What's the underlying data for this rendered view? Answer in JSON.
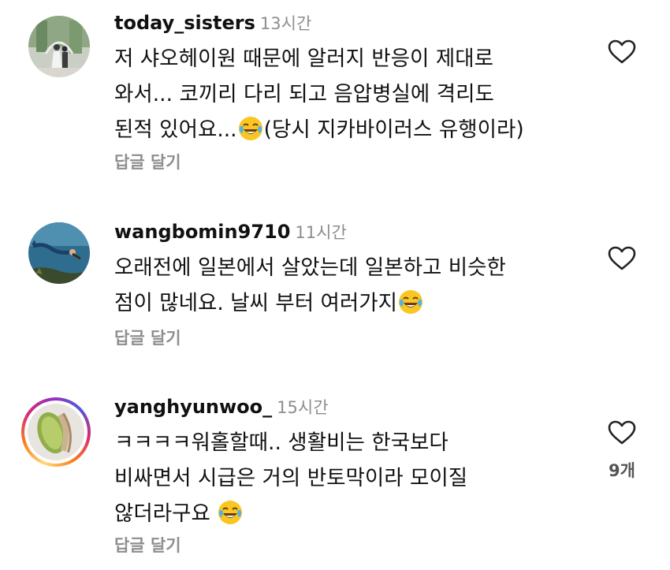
{
  "comments": [
    {
      "username": "today_sisters",
      "time": "13시간",
      "lines": [
        "저 샤오헤이원 때문에 알러지 반응이 제대로",
        "와서... 코끼리 다리 되고 음압병실에 격리도",
        "된적 있어요..."
      ],
      "line3_suffix": "(당시 지카바이러스 유행이라)",
      "emoji": "face-with-tears-of-joy",
      "reply_label": "답글 달기",
      "avatar_icon": "wedding-photo-avatar",
      "like_icon": "heart-outline-icon"
    },
    {
      "username": "wangbomin9710",
      "time": "11시간",
      "lines": [
        "오래전에 일본에서 살았는데 일본하고 비슷한",
        "점이 많네요. 날씨 부터 여러가지"
      ],
      "emoji": "face-with-tears-of-joy",
      "reply_label": "답글 달기",
      "avatar_icon": "mermaid-underwater-avatar",
      "like_icon": "heart-outline-icon"
    },
    {
      "username": "yanghyunwoo_",
      "time": "15시간",
      "lines": [
        "ㅋㅋㅋㅋ워홀할때.. 생활비는 한국보다",
        "비싸면서 시급은 거의 반토막이라 모이질",
        "않더라구요 "
      ],
      "emoji": "face-with-tears-of-joy",
      "reply_label": "답글 달기",
      "like_count": "9개",
      "avatar_icon": "pistachio-avatar",
      "like_icon": "heart-outline-icon"
    }
  ],
  "colors": {
    "meta_text": "#8e8e8e",
    "body_text": "#111111",
    "background": "#ffffff",
    "emoji_face": "#f9c623"
  }
}
